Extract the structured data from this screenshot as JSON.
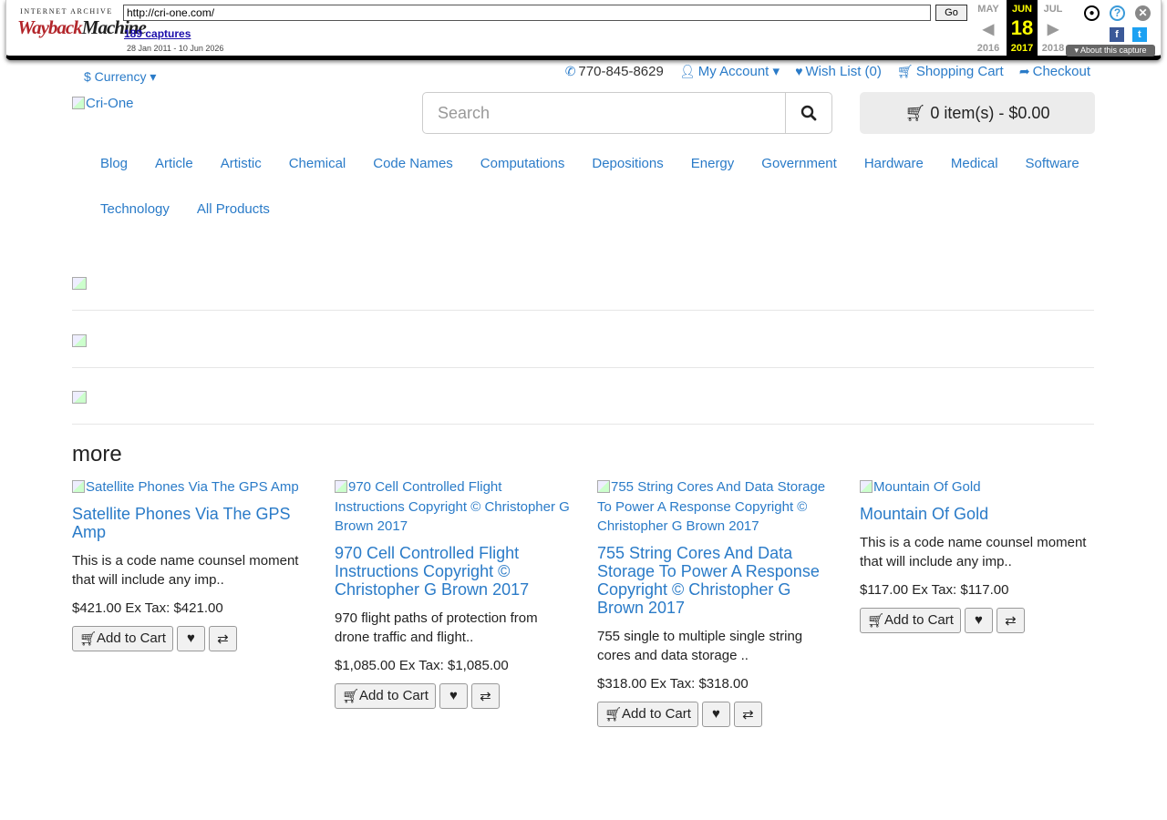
{
  "wayback": {
    "logo_top": "INTERNET ARCHIVE",
    "logo_main_a": "Wayback",
    "logo_main_b": "Machine",
    "url": "http://cri-one.com/",
    "go_label": "Go",
    "captures": "189 captures",
    "range": "28 Jan 2011 - 10 Jun 2026",
    "prev_month": "MAY",
    "cur_month": "JUN",
    "next_month": "JUL",
    "day": "18",
    "prev_year": "2016",
    "cur_year": "2017",
    "next_year": "2018",
    "about": "▾ About this capture"
  },
  "topbar": {
    "currency": "$ Currency ▾",
    "phone": "770-845-8629",
    "account": "My Account ▾",
    "wishlist": "Wish List (0)",
    "cart_link": "Shopping Cart",
    "checkout": "Checkout"
  },
  "header": {
    "logo_alt": "Cri-One",
    "search_placeholder": "Search",
    "cart_summary": "0 item(s) - $0.00"
  },
  "menu": [
    "Blog",
    "Article",
    "Artistic",
    "Chemical",
    "Code Names",
    "Computations",
    "Depositions",
    "Energy",
    "Government",
    "Hardware",
    "Medical",
    "Software",
    "Technology",
    "All Products"
  ],
  "section_title": "more",
  "products": [
    {
      "img_alt": "Satellite Phones Via The GPS Amp",
      "title": "Satellite Phones Via The GPS Amp",
      "desc": "This is a code name counsel moment that will include any imp..",
      "price": "$421.00 Ex Tax: $421.00",
      "add_label": "Add to Cart"
    },
    {
      "img_alt": "970 Cell Controlled Flight Instructions Copyright © Christopher G Brown 2017",
      "title": "970 Cell Controlled Flight Instructions Copyright © Christopher G Brown 2017",
      "desc": "970 flight paths of protection from drone traffic and flight..",
      "price": "$1,085.00 Ex Tax: $1,085.00",
      "add_label": "Add to Cart"
    },
    {
      "img_alt": "755 String Cores And Data Storage To Power A Response Copyright © Christopher G Brown 2017",
      "title": "755 String Cores And Data Storage To Power A Response Copyright © Christopher G Brown 2017",
      "desc": "755 single to multiple single string cores and data storage ..",
      "price": "$318.00 Ex Tax: $318.00",
      "add_label": "Add to Cart"
    },
    {
      "img_alt": "Mountain Of Gold",
      "title": "Mountain Of Gold",
      "desc": "This is a code name counsel moment that will include any imp..",
      "price": "$117.00 Ex Tax: $117.00",
      "add_label": "Add to Cart"
    }
  ],
  "colors": {
    "link": "#2a7bc8",
    "wayback_red": "#b3262b",
    "calendar_highlight": "#ffff00"
  }
}
